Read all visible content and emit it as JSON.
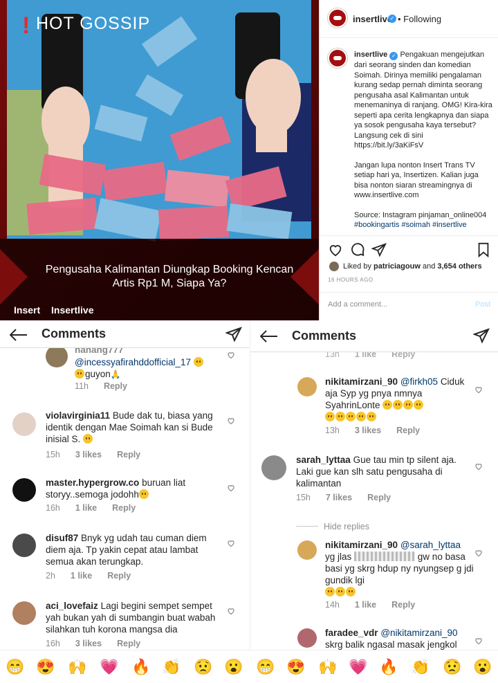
{
  "post_image": {
    "badge": "HOT GOSSIP",
    "caption": "Pengusaha Kalimantan Diungkap Booking Kencan Artis Rp1 M, Siapa Ya?",
    "brand_left": "Insert",
    "brand_right": "Insertlive"
  },
  "ig_post": {
    "username": "insertlive",
    "follow_status": "• Following",
    "caption_paragraphs": [
      "Pengakuan mengejutkan dari seorang sinden dan komedian Soimah. Dirinya memiliki pengalaman kurang sedap pernah diminta seorang pengusaha asal Kalimantan untuk menemaninya di ranjang. OMG! Kira-kira seperti apa cerita lengkapnya dan siapa ya sosok pengusaha kaya tersebut? Langsung cek di sini https://bit.ly/3aKiFsV",
      "Jangan lupa nonton Insert Trans TV setiap hari ya, Insertizen. Kalian juga bisa nonton siaran streamingnya di www.insertlive.com",
      "Source: Instagram pinjaman_online004"
    ],
    "hashtags": "#bookingartis #soimah #insertlive",
    "liked_by_prefix": "Liked by",
    "liked_by_user": "patriciagouw",
    "liked_by_suffix": "and",
    "liked_count": "3,654 others",
    "time_ago": "16 HOURS AGO",
    "add_comment_placeholder": "Add a comment...",
    "post_label": "Post"
  },
  "left_panel": {
    "title": "Comments",
    "comments": [
      {
        "user": "nanang777",
        "text": "@incessyafirahddofficial_17 guyon",
        "time": "11h",
        "likes": "",
        "reply": "Reply"
      },
      {
        "user": "violavirginia11",
        "text": "Bude dak tu, biasa yang identik dengan Mae Soimah kan si Bude inisial S.",
        "time": "15h",
        "likes": "3 likes",
        "reply": "Reply"
      },
      {
        "user": "master.hypergrow.co",
        "text": "buruan liat storyy..semoga jodohh",
        "time": "16h",
        "likes": "1 like",
        "reply": "Reply"
      },
      {
        "user": "disuf87",
        "text": "Bnyk yg udah tau cuman diem diem aja. Tp yakin cepat atau lambat semua akan terungkap.",
        "time": "2h",
        "likes": "1 like",
        "reply": "Reply"
      },
      {
        "user": "aci_lovefaiz",
        "text": "Lagi begini sempet sempet yah  bukan yah di sumbangin buat wabah silahkan tuh korona mangsa dia",
        "time": "16h",
        "likes": "3 likes",
        "reply": "Reply"
      }
    ]
  },
  "right_panel": {
    "title": "Comments",
    "top_meta": {
      "time": "13h",
      "likes": "1 like",
      "reply": "Reply"
    },
    "comments": [
      {
        "user": "nikitamirzani_90",
        "mention": "@firkh05",
        "text": "Ciduk aja Syp yg pnya nmnya SyahrinLonte",
        "time": "13h",
        "likes": "3 likes",
        "reply": "Reply"
      },
      {
        "user": "sarah_lyttaa",
        "text": "Gue tau min tp silent aja. Laki gue kan slh satu pengusaha di kalimantan",
        "time": "15h",
        "likes": "7 likes",
        "reply": "Reply"
      },
      {
        "user": "nikitamirzani_90",
        "mention": "@sarah_lyttaa",
        "text_a": "yg jlas",
        "text_b": "gw no basa basi yg skrg hdup ny nyungsep g jdi gundik lgi",
        "time": "14h",
        "likes": "1 like",
        "reply": "Reply"
      },
      {
        "user": "faradee_vdr",
        "mention": "@nikitamirzani_90",
        "text": "skrg balik ngasal  masak jengkol"
      }
    ],
    "hide_replies": "Hide replies"
  },
  "emoji_bar": [
    "😁",
    "😍",
    "🙌",
    "💗",
    "🔥",
    "👏",
    "😟",
    "😮",
    "😁",
    "😍",
    "🙌",
    "💗",
    "🔥",
    "👏",
    "😟",
    "😮"
  ]
}
